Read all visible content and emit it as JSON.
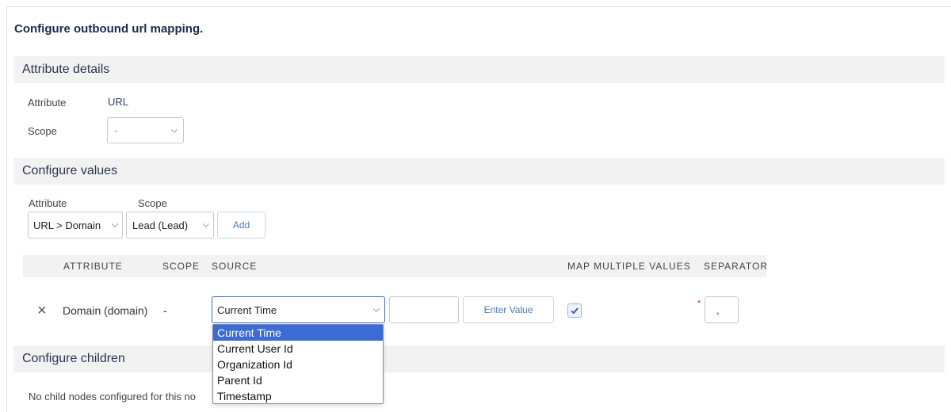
{
  "title": "Configure outbound url mapping.",
  "sections": {
    "attribute_details": "Attribute details",
    "configure_values": "Configure values",
    "configure_children": "Configure children"
  },
  "attribute_details": {
    "attribute_label": "Attribute",
    "attribute_value": "URL",
    "scope_label": "Scope",
    "scope_value": "-"
  },
  "configure_values": {
    "attribute_label": "Attribute",
    "scope_label": "Scope",
    "attribute_select": "URL > Domain",
    "scope_select": "Lead (Lead)",
    "add_button": "Add"
  },
  "table": {
    "headers": [
      "ATTRIBUTE",
      "SCOPE",
      "SOURCE",
      "MAP MULTIPLE VALUES",
      "SEPARATOR"
    ],
    "row": {
      "remove_icon": "×",
      "attribute": "Domain (domain)",
      "scope": "-",
      "source": "Current Time",
      "enter_value_button": "Enter Value",
      "map_multiple_values": true,
      "required_marker": "*",
      "separator": ","
    }
  },
  "source_dropdown": {
    "options": [
      "Current Time",
      "Current User Id",
      "Organization Id",
      "Parent Id",
      "Timestamp"
    ],
    "selected": "Current Time"
  },
  "children": {
    "empty_text": "No child nodes configured for this no"
  },
  "icons": {
    "chevron": "chevron-down-icon",
    "check": "checkmark-icon",
    "remove": "close-icon"
  },
  "colors": {
    "section_bg": "#f2f2f2",
    "dropdown_highlight": "#3b6bd6",
    "link_blue": "#4a7ab8"
  }
}
